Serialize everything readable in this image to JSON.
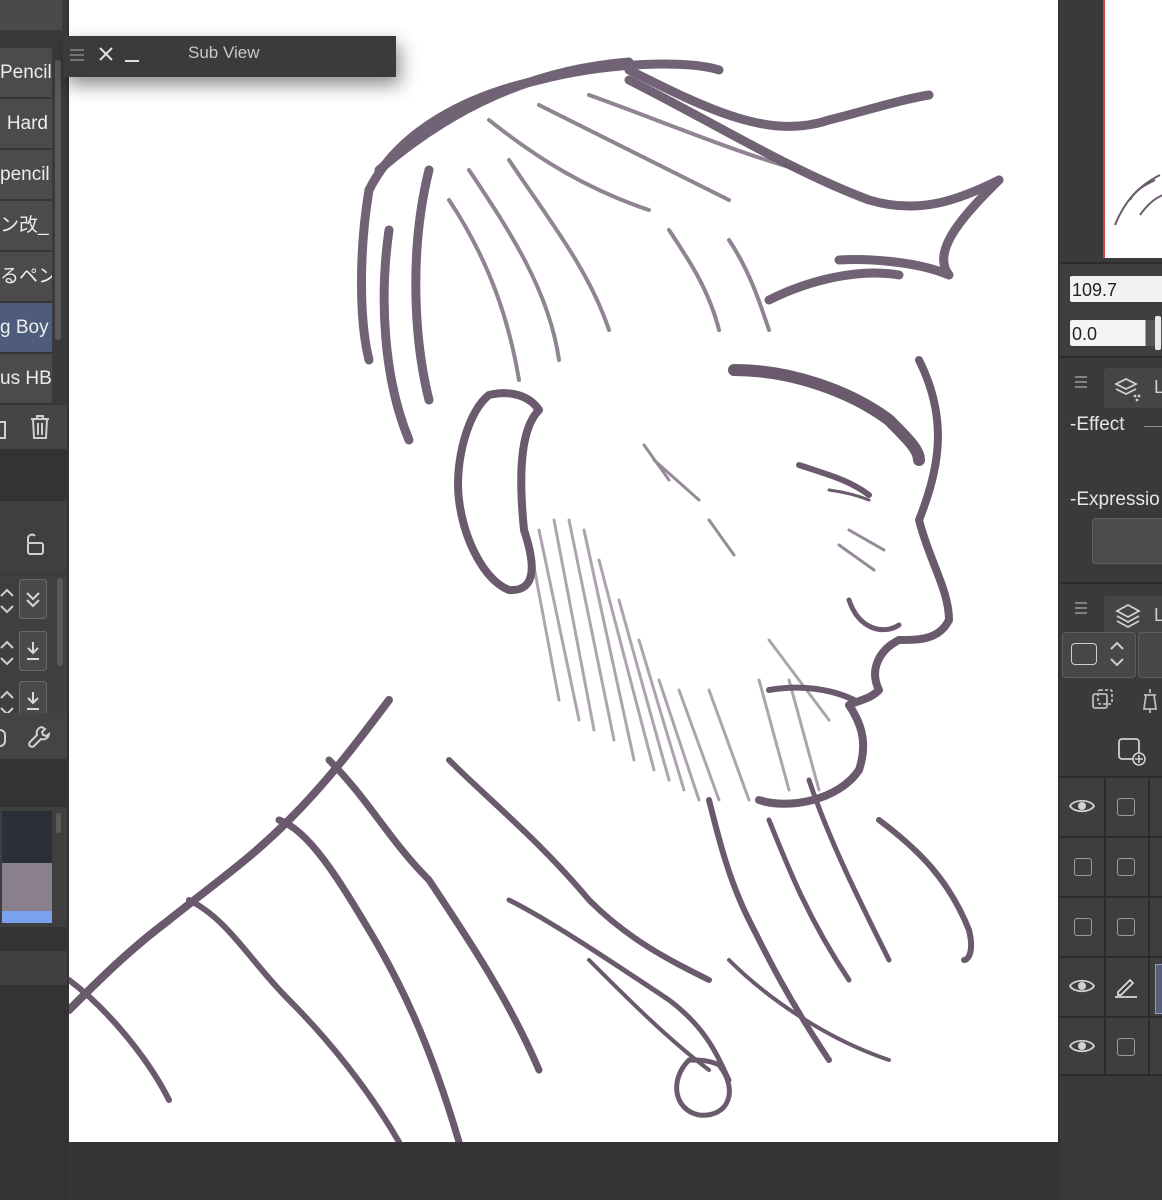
{
  "brushes": [
    {
      "label": "Pencil",
      "selected": false
    },
    {
      "label": "Hard",
      "selected": false
    },
    {
      "label": "pencil",
      "selected": false
    },
    {
      "label": "ン改_",
      "selected": false
    },
    {
      "label": "るペン",
      "selected": false
    },
    {
      "label": "g Boy",
      "selected": true
    },
    {
      "label": "us HB",
      "selected": false
    }
  ],
  "subview": {
    "title": "Sub View"
  },
  "tool_property": {
    "size_value": "109.7",
    "opacity_value": "0.0"
  },
  "panels": {
    "effect_label": "-Effect",
    "expression_label": "-Expressio"
  },
  "colors": {
    "swatch_dark": "#2b3038",
    "swatch_mauve": "#8a7f8c",
    "swatch_blue": "#7aa1ee",
    "stroke": "#6b5a6e",
    "selection": "#56607a"
  },
  "layers": [
    {
      "visible": true,
      "editing": false
    },
    {
      "visible": false,
      "editing": false
    },
    {
      "visible": false,
      "editing": false
    },
    {
      "visible": true,
      "editing": true
    },
    {
      "visible": true,
      "editing": false
    }
  ],
  "icons": [
    "menu-icon",
    "close-icon",
    "minimize-icon",
    "trash-icon",
    "lock-open-icon",
    "up-down-arrows-icon",
    "check-double-icon",
    "download-icon",
    "wrench-icon",
    "layer-property-icon",
    "layers-icon",
    "eye-icon",
    "pen-icon",
    "new-layer-icon"
  ]
}
